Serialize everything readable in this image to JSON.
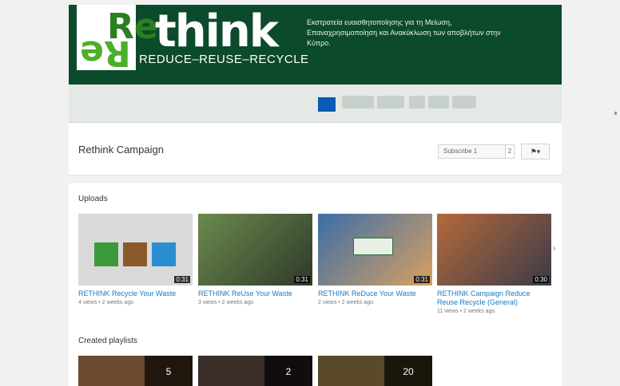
{
  "banner": {
    "logo_re": "Re",
    "logo_think": "think",
    "tagline": "REDUCE–REUSE–RECYCLE",
    "description": "Εκστρατεία ευαισθητοποίησης για τη Μείωση, Επαναχρησιμοποίηση και Ανακύκλωση των αποβλήτων στην Κύπρο."
  },
  "channel": {
    "title": "Rethink Campaign",
    "subscribe_label": "Subscribe 1",
    "subscriber_count": "2",
    "flag_label": "⚑▾"
  },
  "uploads": {
    "title": "Uploads",
    "videos": [
      {
        "title": "RETHINK Recycle Your Waste",
        "meta": "4 views • 2 weeks ago",
        "duration": "0:31"
      },
      {
        "title": "RETHINK ReUse Your Waste",
        "meta": "3 views • 2 weeks ago",
        "duration": "0:31"
      },
      {
        "title": "RETHINK ReDuce Your Waste",
        "meta": "2 views • 2 weeks ago",
        "duration": "0:31"
      },
      {
        "title": "RETHINK Campaign Reduce Reuse Recycle (General)",
        "meta": "11 views • 2 weeks ago",
        "duration": "0:30"
      }
    ]
  },
  "playlists": {
    "title": "Created playlists",
    "items": [
      {
        "count": "5"
      },
      {
        "count": "2"
      },
      {
        "count": "20"
      }
    ]
  },
  "colors": {
    "banner_bg": "#0c4a2c",
    "link": "#167ac6",
    "logo_green": "#4caf2a"
  }
}
